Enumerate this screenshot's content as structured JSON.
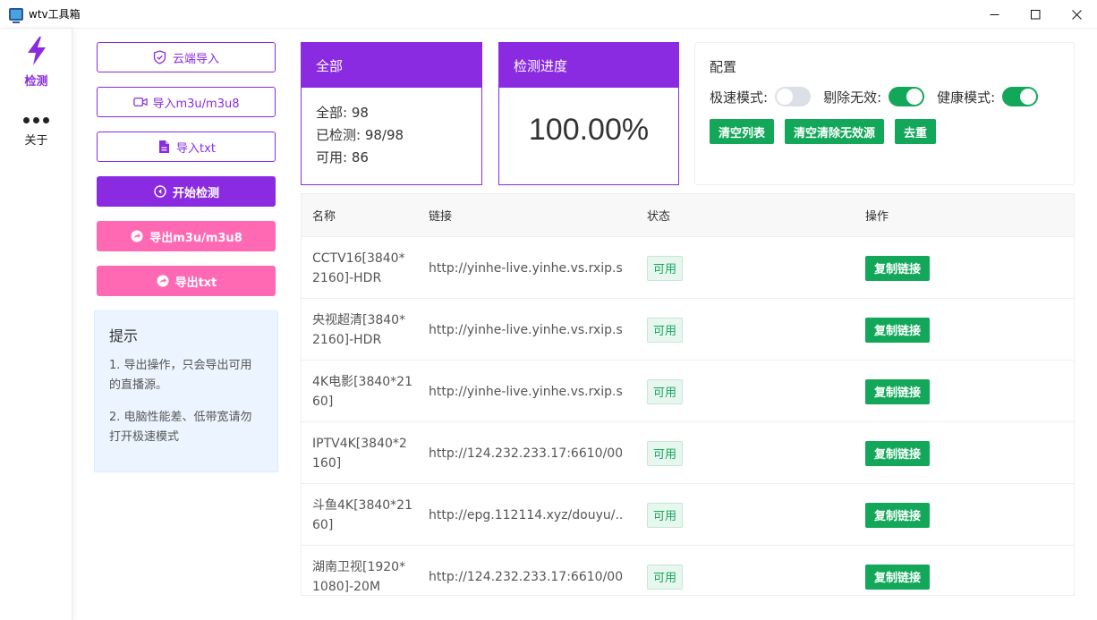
{
  "window": {
    "title": "wtv工具箱",
    "app_icon": "tv-icon",
    "controls": [
      "minimize-icon",
      "maximize-icon",
      "close-icon"
    ]
  },
  "nav": {
    "items": [
      {
        "label": "检测",
        "icon": "lightning-icon",
        "active": true
      },
      {
        "label": "关于",
        "icon": "more-dots-icon",
        "active": false
      }
    ]
  },
  "actions": {
    "cloud_import": "云端导入",
    "import_m3u": "导入m3u/m3u8",
    "import_txt": "导入txt",
    "start_check": "开始检测",
    "export_m3u": "导出m3u/m3u8",
    "export_txt": "导出txt"
  },
  "tips": {
    "title": "提示",
    "items": [
      "1. 导出操作，只会导出可用的直播源。",
      "2. 电脑性能差、低带宽请勿打开极速模式"
    ]
  },
  "stats": {
    "all_title": "全部",
    "all_line": "全部: 98",
    "checked_line": "已检测: 98/98",
    "available_line": "可用: 86",
    "progress_title": "检测进度",
    "progress_value": "100.00%"
  },
  "config": {
    "title": "配置",
    "fast_mode_label": "极速模式:",
    "fast_mode": false,
    "remove_invalid_label": "剔除无效:",
    "remove_invalid": true,
    "health_mode_label": "健康模式:",
    "health_mode": true,
    "clear_list": "清空列表",
    "clear_invalid": "清空清除无效源",
    "dedupe": "去重"
  },
  "table": {
    "headers": {
      "name": "名称",
      "link": "链接",
      "status": "状态",
      "op": "操作"
    },
    "rows": [
      {
        "name": "CCTV16[3840*2160]-HDR",
        "link": "http://yinhe-live.yinhe.vs.rxip.s...",
        "status": "可用",
        "op": "复制链接"
      },
      {
        "name": "央视超清[3840*2160]-HDR",
        "link": "http://yinhe-live.yinhe.vs.rxip.s...",
        "status": "可用",
        "op": "复制链接"
      },
      {
        "name": "4K电影[3840*2160]",
        "link": "http://yinhe-live.yinhe.vs.rxip.s...",
        "status": "可用",
        "op": "复制链接"
      },
      {
        "name": "IPTV4K[3840*2160]",
        "link": "http://124.232.233.17:6610/00...",
        "status": "可用",
        "op": "复制链接"
      },
      {
        "name": "斗鱼4K[3840*2160]",
        "link": "http://epg.112114.xyz/douyu/...",
        "status": "可用",
        "op": "复制链接"
      },
      {
        "name": "湖南卫视[1920*1080]-20M",
        "link": "http://124.232.233.17:6610/00...",
        "status": "可用",
        "op": "复制链接"
      }
    ]
  },
  "colors": {
    "primary": "#8a2be2",
    "pink": "#ff69b4",
    "success": "#13a75a"
  }
}
